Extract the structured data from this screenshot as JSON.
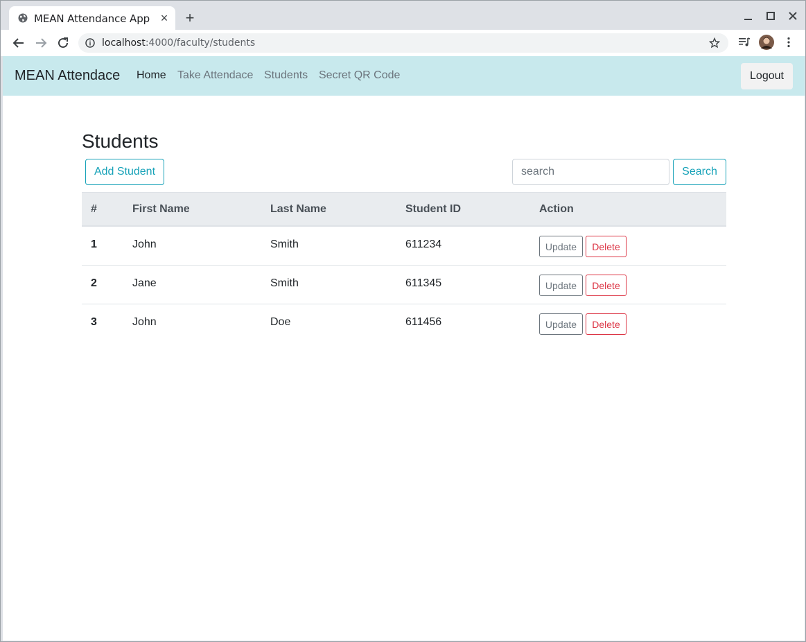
{
  "browser": {
    "tab_title": "MEAN Attendance App",
    "url_host": "localhost",
    "url_path": ":4000/faculty/students"
  },
  "navbar": {
    "brand": "MEAN Attendace",
    "links": [
      {
        "label": "Home",
        "active": true
      },
      {
        "label": "Take Attendace",
        "active": false
      },
      {
        "label": "Students",
        "active": false
      },
      {
        "label": "Secret QR Code",
        "active": false
      }
    ],
    "logout_label": "Logout"
  },
  "main": {
    "title": "Students",
    "add_button": "Add Student",
    "search_placeholder": "search",
    "search_button": "Search",
    "table": {
      "headers": [
        "#",
        "First Name",
        "Last Name",
        "Student ID",
        "Action"
      ],
      "rows": [
        {
          "num": "1",
          "first": "John",
          "last": "Smith",
          "id": "611234"
        },
        {
          "num": "2",
          "first": "Jane",
          "last": "Smith",
          "id": "611345"
        },
        {
          "num": "3",
          "first": "John",
          "last": "Doe",
          "id": "611456"
        }
      ],
      "update_label": "Update",
      "delete_label": "Delete"
    }
  },
  "colors": {
    "navbar_bg": "#c8e9ed",
    "info": "#17a2b8",
    "danger": "#dc3545",
    "secondary": "#6c757d"
  }
}
